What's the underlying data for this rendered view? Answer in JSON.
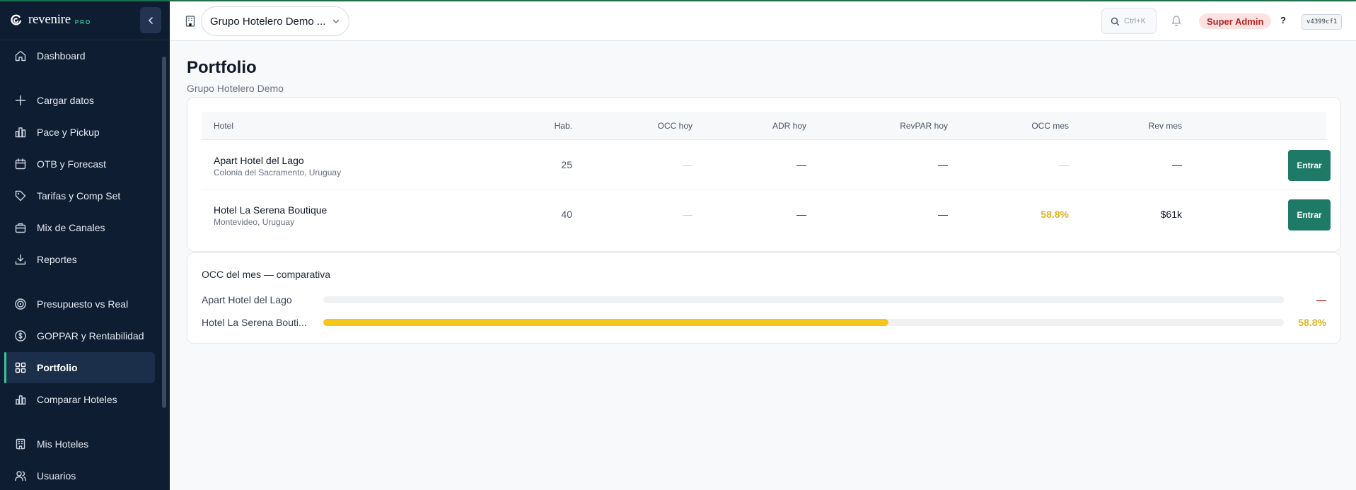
{
  "brand": {
    "name": "revenire",
    "tier": "PRO"
  },
  "colors": {
    "accent": "#1e7a67",
    "occ_fill": "#f5c518",
    "warn": "#e0b321",
    "admin_bg": "#fde2e2",
    "admin_text": "#b42323"
  },
  "sidebar": {
    "items": [
      {
        "label": "Dashboard",
        "icon": "home-icon"
      },
      {
        "label": "Cargar datos",
        "icon": "plus-icon"
      },
      {
        "label": "Pace y Pickup",
        "icon": "bar-chart-icon"
      },
      {
        "label": "OTB y Forecast",
        "icon": "calendar-icon"
      },
      {
        "label": "Tarifas y Comp Set",
        "icon": "tag-icon"
      },
      {
        "label": "Mix de Canales",
        "icon": "briefcase-icon"
      },
      {
        "label": "Reportes",
        "icon": "download-icon"
      },
      {
        "label": "Presupuesto vs Real",
        "icon": "target-icon"
      },
      {
        "label": "GOPPAR y Rentabilidad",
        "icon": "dollar-icon"
      },
      {
        "label": "Portfolio",
        "icon": "grid-icon",
        "active": true
      },
      {
        "label": "Comparar Hoteles",
        "icon": "compare-chart-icon"
      },
      {
        "label": "Mis Hoteles",
        "icon": "building-icon"
      },
      {
        "label": "Usuarios",
        "icon": "users-icon"
      }
    ]
  },
  "header": {
    "org_selector": "Grupo Hotelero Demo ...",
    "search_shortcut": "Ctrl+K",
    "role_badge": "Super Admin",
    "help": "?",
    "version": "v4399cf1"
  },
  "main": {
    "title": "Portfolio",
    "subtitle": "Grupo Hotelero Demo",
    "table": {
      "columns": [
        "Hotel",
        "Hab.",
        "OCC hoy",
        "ADR hoy",
        "RevPAR hoy",
        "OCC mes",
        "Rev mes"
      ],
      "rows": [
        {
          "name": "Apart Hotel del Lago",
          "location": "Colonia del Sacramento, Uruguay",
          "rooms": "25",
          "occ_today": "—",
          "adr_today": "—",
          "revpar_today": "—",
          "occ_month": "—",
          "rev_month": "—",
          "action": "Entrar"
        },
        {
          "name": "Hotel La Serena Boutique",
          "location": "Montevideo, Uruguay",
          "rooms": "40",
          "occ_today": "—",
          "adr_today": "—",
          "revpar_today": "—",
          "occ_month": "58.8%",
          "rev_month": "$61k",
          "action": "Entrar"
        }
      ]
    },
    "occ_compare": {
      "title": "OCC del mes — comparativa",
      "bars": [
        {
          "label": "Apart Hotel del Lago",
          "value": null,
          "display": "—",
          "color": "#b42323"
        },
        {
          "label": "Hotel La Serena Bouti...",
          "value": 58.8,
          "display": "58.8%",
          "color": "#e0b321"
        }
      ]
    }
  }
}
